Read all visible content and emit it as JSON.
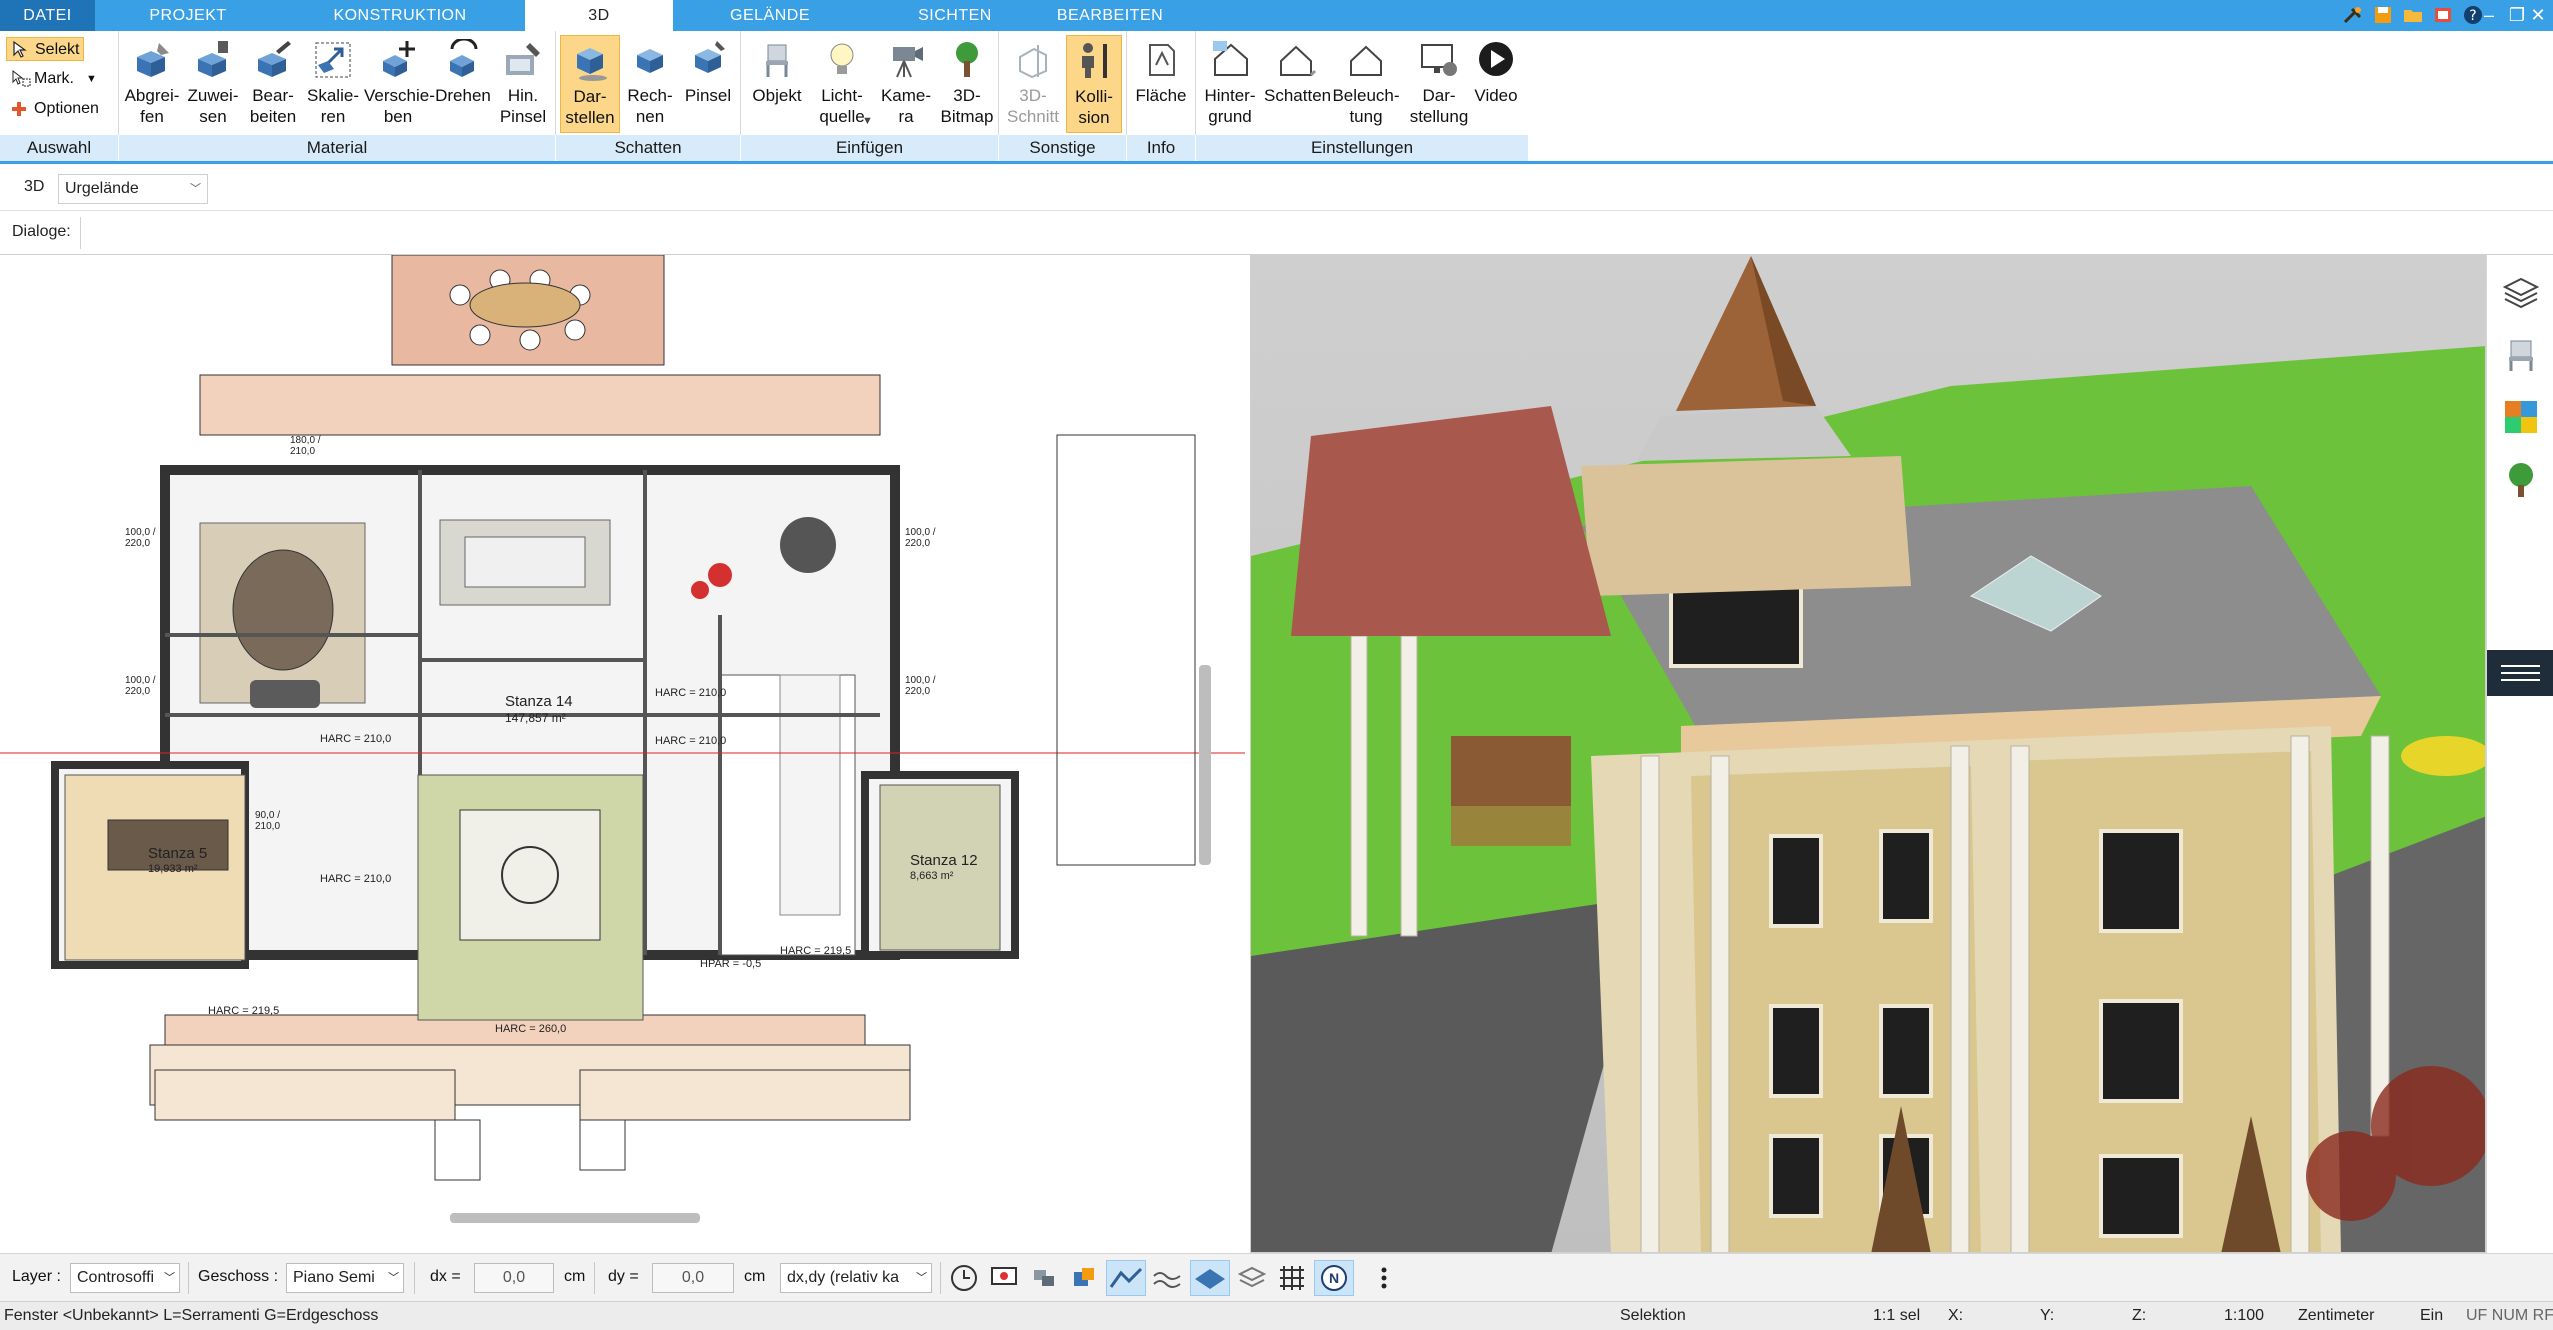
{
  "tabs": [
    {
      "label": "DATEI"
    },
    {
      "label": "PROJEKT"
    },
    {
      "label": "KONSTRUKTION"
    },
    {
      "label": "3D"
    },
    {
      "label": "GELÄNDE"
    },
    {
      "label": "SICHTEN"
    },
    {
      "label": "BEARBEITEN"
    }
  ],
  "ribbon": {
    "auswahl": {
      "items": [
        {
          "label": "Selekt"
        },
        {
          "label": "Mark."
        },
        {
          "label": "Optionen"
        }
      ],
      "group_label": "Auswahl"
    },
    "material": {
      "buttons": [
        {
          "l1": "Abgrei-",
          "l2": "fen"
        },
        {
          "l1": "Zuwei-",
          "l2": "sen"
        },
        {
          "l1": "Bear-",
          "l2": "beiten"
        },
        {
          "l1": "Skalie-",
          "l2": "ren"
        },
        {
          "l1": "Verschie-",
          "l2": "ben"
        },
        {
          "l1": "Drehen",
          "l2": ""
        },
        {
          "l1": "Hin.",
          "l2": "Pinsel"
        }
      ],
      "group_label": "Material"
    },
    "schatten": {
      "buttons": [
        {
          "l1": "Dar-",
          "l2": "stellen"
        },
        {
          "l1": "Rech-",
          "l2": "nen"
        },
        {
          "l1": "Pinsel",
          "l2": ""
        }
      ],
      "group_label": "Schatten"
    },
    "einfuegen": {
      "buttons": [
        {
          "l1": "Objekt",
          "l2": ""
        },
        {
          "l1": "Licht-",
          "l2": "quelle"
        },
        {
          "l1": "Kame-",
          "l2": "ra"
        },
        {
          "l1": "3D-",
          "l2": "Bitmap"
        }
      ],
      "group_label": "Einfügen"
    },
    "sonstige": {
      "buttons": [
        {
          "l1": "3D-",
          "l2": "Schnitt"
        },
        {
          "l1": "Kolli-",
          "l2": "sion"
        }
      ],
      "group_label": "Sonstige"
    },
    "info": {
      "buttons": [
        {
          "l1": "Fläche",
          "l2": ""
        }
      ],
      "group_label": "Info"
    },
    "einstellungen": {
      "buttons": [
        {
          "l1": "Hinter-",
          "l2": "grund"
        },
        {
          "l1": "Schatten",
          "l2": ""
        },
        {
          "l1": "Beleuch-",
          "l2": "tung"
        },
        {
          "l1": "Dar-",
          "l2": "stellung"
        },
        {
          "l1": "Video",
          "l2": ""
        }
      ],
      "group_label": "Einstellungen"
    }
  },
  "subbar": {
    "mode": "3D",
    "terrain_value": "Urgelände"
  },
  "dialogbar": {
    "label": "Dialoge:"
  },
  "plan": {
    "rooms": [
      {
        "label": "Stanza 14",
        "area": "147,857 m²"
      },
      {
        "label": "Stanza 5",
        "area": "19,933 m²"
      },
      {
        "label": "Stanza 12",
        "area": "8,663 m²"
      }
    ],
    "annotations": {
      "harc_210": "HARC = 210,0",
      "harc_2195": "HARC = 219,5",
      "harc_260": "HARC = 260,0",
      "hpar_05": "HPAR = -0,5",
      "dim_100_220": "100,0 / 220,0",
      "dim_90_210": "90,0 / 210,0",
      "dim_180_210": "180,0 / 210,0"
    }
  },
  "bottombar": {
    "layer_label": "Layer :",
    "layer_value": "Controsoffi",
    "geschoss_label": "Geschoss :",
    "geschoss_value": "Piano Semi",
    "dx_label": "dx =",
    "dx_value": "0,0",
    "dx_unit": "cm",
    "dy_label": "dy =",
    "dy_value": "0,0",
    "dy_unit": "cm",
    "mode_value": "dx,dy (relativ ka"
  },
  "statusbar": {
    "left": "Fenster <Unbekannt> L=Serramenti G=Erdgeschoss",
    "selektion": "Selektion",
    "sel": "1:1 sel",
    "x": "X:",
    "y": "Y:",
    "z": "Z:",
    "scale": "1:100",
    "unit": "Zentimeter",
    "ein": "Ein",
    "flags": "UF NUM RF"
  },
  "colors": {
    "accent": "#3aa0e6",
    "file_tab": "#1f73b7",
    "active_button": "#fcd78a",
    "group_label_bg": "#d7ebfa"
  }
}
